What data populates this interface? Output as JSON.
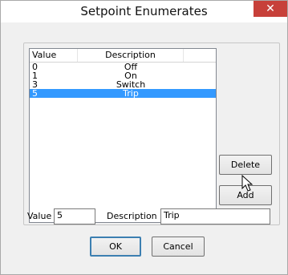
{
  "window": {
    "title": "Setpoint Enumerates",
    "close_glyph": "✕"
  },
  "listview": {
    "columns": [
      "Value",
      "Description"
    ],
    "rows": [
      {
        "value": "0",
        "description": "Off"
      },
      {
        "value": "1",
        "description": "On"
      },
      {
        "value": "3",
        "description": "Switch"
      },
      {
        "value": "5",
        "description": "Trip"
      }
    ],
    "selected_index": 3
  },
  "buttons": {
    "delete": "Delete",
    "add": "Add",
    "ok": "OK",
    "cancel": "Cancel"
  },
  "form": {
    "value_label": "Value",
    "value": "5",
    "description_label": "Description",
    "description": "Trip"
  },
  "colors": {
    "selection": "#3399ff",
    "close": "#c7403a"
  },
  "icons": {
    "cursor": "arrow-cursor-icon"
  }
}
